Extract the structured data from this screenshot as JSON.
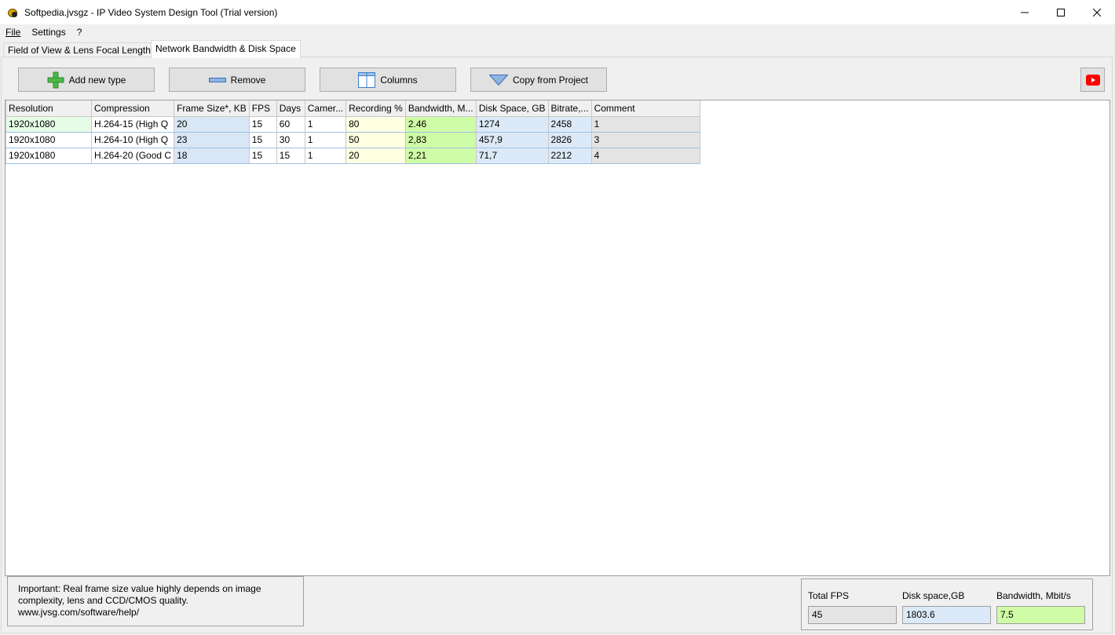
{
  "window": {
    "title": "Softpedia.jvsgz - IP Video System Design Tool (Trial version)"
  },
  "menu": {
    "file": "File",
    "settings": "Settings",
    "help": "?"
  },
  "tabs": [
    {
      "label": "Field of View & Lens Focal Length"
    },
    {
      "label": "Network Bandwidth & Disk Space"
    }
  ],
  "toolbar": {
    "add_label": "Add new type",
    "remove_label": "Remove",
    "columns_label": "Columns",
    "copy_label": "Copy from Project"
  },
  "grid": {
    "columns": [
      "Resolution",
      "Compression",
      "Frame Size*, KB",
      "FPS",
      "Days",
      "Camer...",
      "Recording %",
      "Bandwidth, M...",
      "Disk Space, GB",
      "Bitrate,...",
      "Comment"
    ],
    "rows": [
      {
        "resolution": "1920x1080",
        "compression": "H.264-15 (High Q",
        "frame": "20",
        "fps": "15",
        "days": "60",
        "cameras": "1",
        "recording": "80",
        "bandwidth": "2.46",
        "disk": "1274",
        "bitrate": "2458",
        "comment": "1"
      },
      {
        "resolution": "1920x1080",
        "compression": "H.264-10 (High Q",
        "frame": "23",
        "fps": "15",
        "days": "30",
        "cameras": "1",
        "recording": "50",
        "bandwidth": "2,83",
        "disk": "457,9",
        "bitrate": "2826",
        "comment": "3"
      },
      {
        "resolution": "1920x1080",
        "compression": "H.264-20 (Good C",
        "frame": "18",
        "fps": "15",
        "days": "15",
        "cameras": "1",
        "recording": "20",
        "bandwidth": "2,21",
        "disk": "71,7",
        "bitrate": "2212",
        "comment": "4"
      }
    ]
  },
  "note": {
    "line1": "Important: Real frame size value highly depends on image",
    "line2": "complexity, lens and CCD/CMOS quality.",
    "line3": "www.jvsg.com/software/help/"
  },
  "totals": {
    "fps_label": "Total FPS",
    "fps_value": "45",
    "disk_label": "Disk space,GB",
    "disk_value": "1803.6",
    "bw_label": "Bandwidth, Mbit/s",
    "bw_value": "7.5"
  },
  "colors": {
    "bandwidth_cell": "#cffca6",
    "disk_cell": "#dce9f8",
    "recording_cell": "#fefee0",
    "youtube_red": "#ff0000"
  }
}
